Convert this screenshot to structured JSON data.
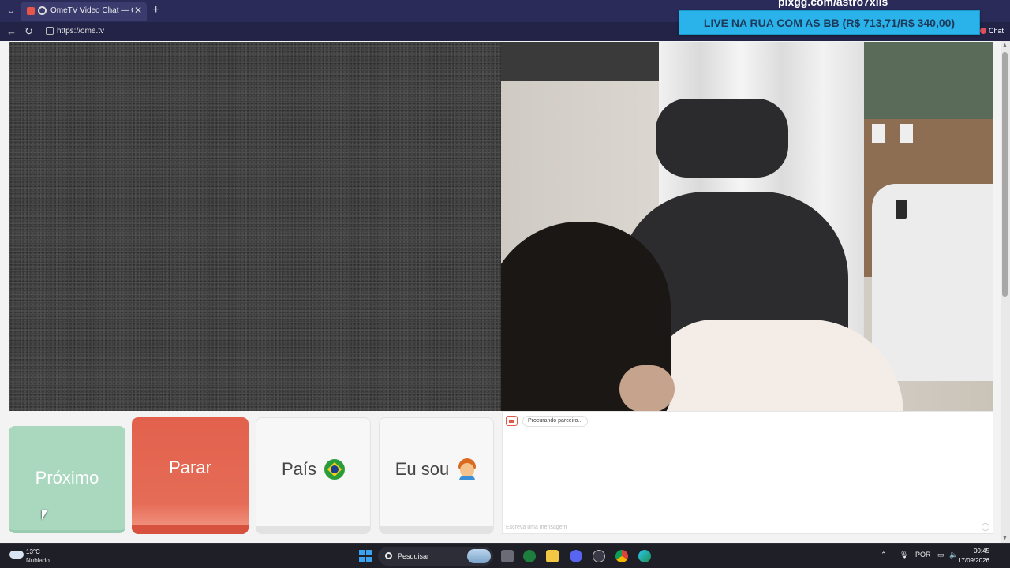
{
  "browser": {
    "tab": {
      "title": "OmeTV Video Chat — Omegle",
      "close": "✕"
    },
    "new_tab": "+",
    "url": "https://ome.tv",
    "chat_label": "Chat"
  },
  "overlay": {
    "url_text": "pixgg.com/astro7xlis",
    "banner_text": "LIVE NA RUA COM AS BB (R$ 713,71/R$ 340,00)",
    "banner_color": "#2ab3ea"
  },
  "controls": {
    "next_label": "Próximo",
    "stop_label": "Parar",
    "country_label": "País",
    "country_flag_icon": "brazil-flag",
    "gender_label": "Eu sou",
    "gender_icon": "boy-emoji"
  },
  "chat": {
    "status": "Procurando parceiro...",
    "input_placeholder": "Escreva uma mensagem"
  },
  "taskbar": {
    "weather_temp": "13°C",
    "weather_desc": "Nublado",
    "search_label": "Pesquisar",
    "language": "POR",
    "time": "00:45",
    "date": "17/09/2026"
  },
  "colors": {
    "next_button": "#a9d8bf",
    "stop_button": "#e2614d",
    "tab_bar": "#2b2b5a"
  }
}
